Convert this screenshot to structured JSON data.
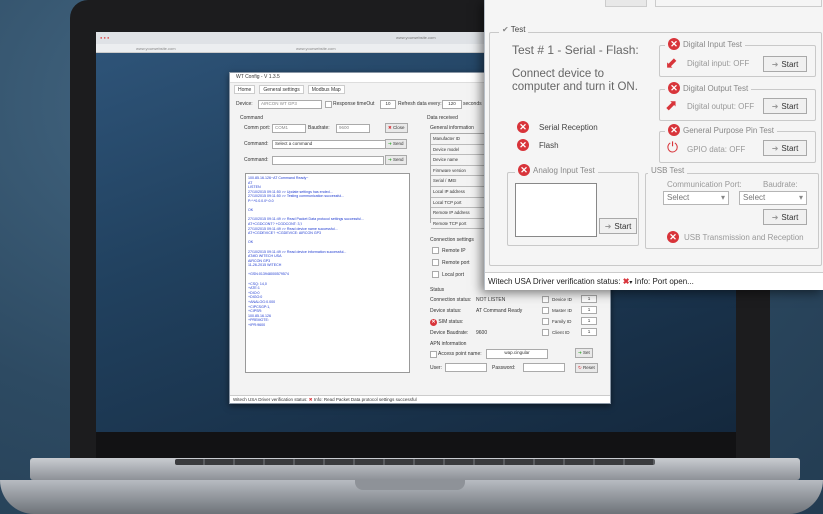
{
  "browser": {
    "url": "www.yourwebsite.com",
    "tab1": "www.yourwebsite.com",
    "tab2": "www.yourwebsite.com"
  },
  "app": {
    "title": "WT Config - V 1.3.5",
    "tabs": [
      "Home",
      "General settings",
      "Modbus Map"
    ],
    "device_label": "Device:",
    "device_value": "AIRCON WT GP3",
    "response_timeout_label": "Response timeOut",
    "response_timeout_value": "10",
    "refresh_label": "Refresh data every:",
    "refresh_value": "120",
    "refresh_unit": "seconds",
    "command_group": "Command",
    "comm_port_label": "Comm port:",
    "comm_port_value": "COM1",
    "baudrate_label": "Baudrate:",
    "baudrate_value": "9600",
    "close_button": "Close",
    "command_label": "Command:",
    "command_placeholder": "Select a command",
    "send_button": "Send",
    "data_received_group": "Data received",
    "general_information": "General information",
    "info_fields": [
      "Manufacter ID",
      "Device model",
      "Device name",
      "Firmware version",
      "Serial / IMEI",
      "Local IP address",
      "Local TCP port",
      "Remote IP address",
      "Remote TCP port"
    ],
    "connection_settings": "Connection settings",
    "connection_items": [
      "Remote IP",
      "Remote port",
      "Local port"
    ],
    "status_group": "Status",
    "connection_status_label": "Connection status:",
    "connection_status_value": "NOT LISTEN",
    "device_status_label": "Device status:",
    "device_status_value": "AT Command Ready",
    "sim_status_label": "SIM status:",
    "device_baudrate_label": "Device Baudrate:",
    "device_baudrate_value": "9600",
    "ids": [
      {
        "label": "Device ID",
        "value": "1"
      },
      {
        "label": "Master ID",
        "value": "1"
      },
      {
        "label": "Family ID",
        "value": "1"
      },
      {
        "label": "Client ID",
        "value": "1"
      }
    ],
    "apn_group": "APN information",
    "access_point_label": "Access point name:",
    "access_point_value": "wap.cingular",
    "set_button": "Set",
    "user_label": "User:",
    "password_label": "Password:",
    "reset_button": "Reset",
    "log_lines": [
      "100.85.16.126~AT Command Ready~",
      "AT",
      "LISTEN",
      "27/10/2015 09:11:50 >> Update settings has ended...",
      "27/10/2015 09:11:50 >> Testing communication successful...",
      "P:*:*0.0.0.0*:0.0",
      "",
      "OK",
      "",
      "27/10/2015 09:11:49 >> Read Packet Data protocol settings successful...",
      "AT+CGDCONT? +CGDCONT: 3,'I",
      "27/10/2015 09:11:49 >> Read device name successful...",
      "AT+CGDEVICE? +CGDEVICE: AIRCON GP3",
      "",
      "OK",
      "",
      "27/10/2015 09:11:49 >> Read device information successful...",
      "AT#ID WITECH USA",
      "AIRCON GP3",
      "11-26-2015 WITECH",
      "",
      "+GSN:013948000579574",
      "",
      "+CSQ: 14,0",
      "+ATE:1",
      "+DIO:0",
      "+DIGO:0",
      "+ANALOG:0.000",
      "+CIPCSGP:1,",
      "+CIPSR:",
      "100.85.16.126",
      "+PREMOTE:",
      "+IPR:9600"
    ],
    "status_text": "Witech USA Driver verification status:",
    "status_info": "Info: Read Packet Data protocol settings successful"
  },
  "panel": {
    "test_group": "Test",
    "test_title": "Test # 1 - Serial - Flash:",
    "test_instruction": "Connect device to computer and turn it ON.",
    "serial_reception": "Serial Reception",
    "flash": "Flash",
    "analog_input_test": "Analog Input Test",
    "start_button": "Start",
    "digital_input_test": "Digital Input Test",
    "digital_input_value": "Digital input: OFF",
    "digital_output_test": "Digital Output Test",
    "digital_output_value": "Digital output: OFF",
    "gpio_test": "General Purpose Pin Test",
    "gpio_value": "GPIO data: OFF",
    "usb_test": "USB Test",
    "comm_port_label": "Communication Port:",
    "baudrate_label": "Baudrate:",
    "select_placeholder": "Select",
    "usb_transmission": "USB Transmission and Reception",
    "status_text": "Witech USA Driver verification status:",
    "status_info": "Info: Port open..."
  },
  "colors": {
    "error_red": "#d8343a",
    "desktop_blue": "#2e4d66",
    "send_green": "#3aa635"
  }
}
